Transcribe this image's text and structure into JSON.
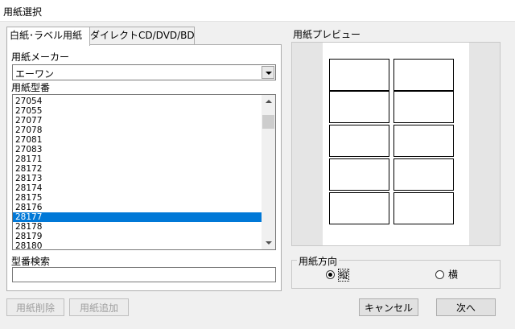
{
  "window": {
    "title": "用紙選択"
  },
  "tabs": [
    {
      "label": "白紙･ラベル用紙",
      "active": true
    },
    {
      "label": "ダイレクトCD/DVD/BD",
      "active": false
    }
  ],
  "manufacturer": {
    "label": "用紙メーカー",
    "value": "エーワン"
  },
  "model": {
    "label": "用紙型番",
    "items": [
      "27054",
      "27055",
      "27077",
      "27078",
      "27081",
      "27083",
      "28171",
      "28172",
      "28173",
      "28174",
      "28175",
      "28176",
      "28177",
      "28178",
      "28179",
      "28180"
    ],
    "selected": "28177"
  },
  "search": {
    "label": "型番検索",
    "value": ""
  },
  "preview": {
    "label": "用紙プレビュー"
  },
  "orientation": {
    "label": "用紙方向",
    "portrait": "縦",
    "landscape": "横",
    "selected": "portrait"
  },
  "buttons": {
    "delete": "用紙削除",
    "add": "用紙追加",
    "cancel": "キャンセル",
    "next": "次へ"
  },
  "colors": {
    "selection": "#0078d7"
  }
}
